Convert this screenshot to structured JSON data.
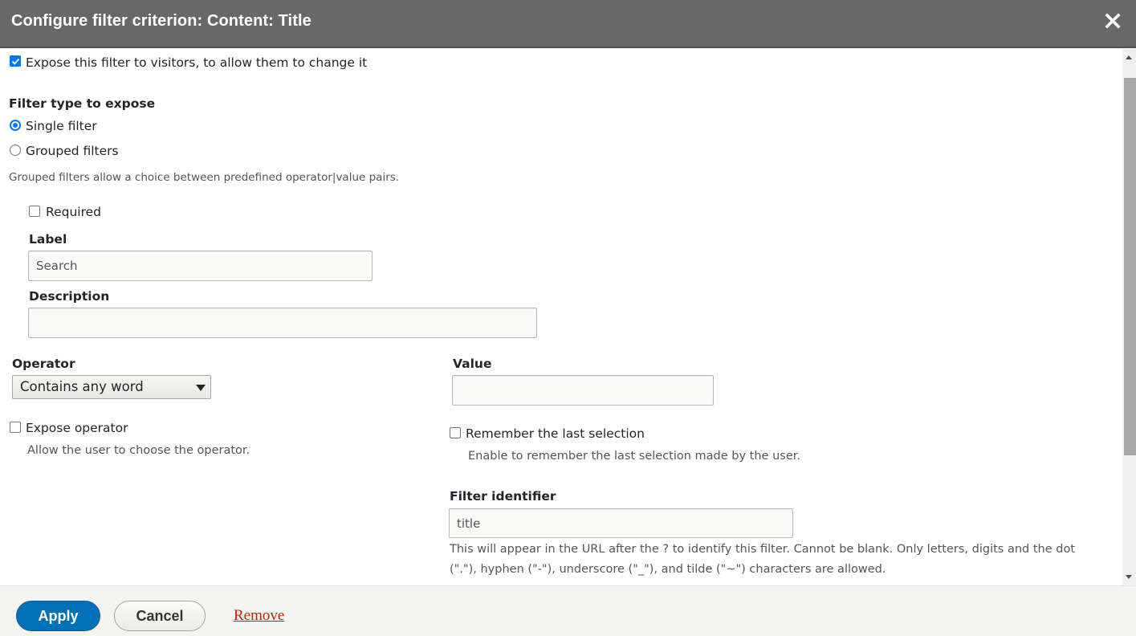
{
  "dialog": {
    "title": "Configure filter criterion: Content: Title",
    "close_icon": "close-icon"
  },
  "expose": {
    "checkbox_label": "Expose this filter to visitors, to allow them to change it",
    "checked": true
  },
  "filter_type": {
    "heading": "Filter type to expose",
    "options": [
      {
        "label": "Single filter",
        "selected": true
      },
      {
        "label": "Grouped filters",
        "selected": false
      }
    ],
    "description": "Grouped filters allow a choice between predefined operator|value pairs."
  },
  "required": {
    "label": "Required",
    "checked": false
  },
  "label_field": {
    "label": "Label",
    "value": "Search"
  },
  "description_field": {
    "label": "Description",
    "value": ""
  },
  "operator": {
    "label": "Operator",
    "selected": "Contains any word",
    "expose_label": "Expose operator",
    "expose_checked": false,
    "expose_description": "Allow the user to choose the operator."
  },
  "value_field": {
    "label": "Value",
    "value": ""
  },
  "remember": {
    "label": "Remember the last selection",
    "checked": false,
    "description": "Enable to remember the last selection made by the user."
  },
  "identifier": {
    "label": "Filter identifier",
    "value": "title",
    "help_line1": "This will appear in the URL after the ? to identify this filter. Cannot be blank. Only letters, digits and the dot",
    "help_line2": "(\".\"), hyphen (\"-\"), underscore (\"_\"), and tilde (\"~\") characters are allowed."
  },
  "footer": {
    "apply_label": "Apply",
    "cancel_label": "Cancel",
    "remove_label": "Remove"
  },
  "colors": {
    "titlebar": "#686868",
    "primary": "#0071b8",
    "link_danger": "#c72100",
    "checkbox_accent": "#0075ff"
  }
}
